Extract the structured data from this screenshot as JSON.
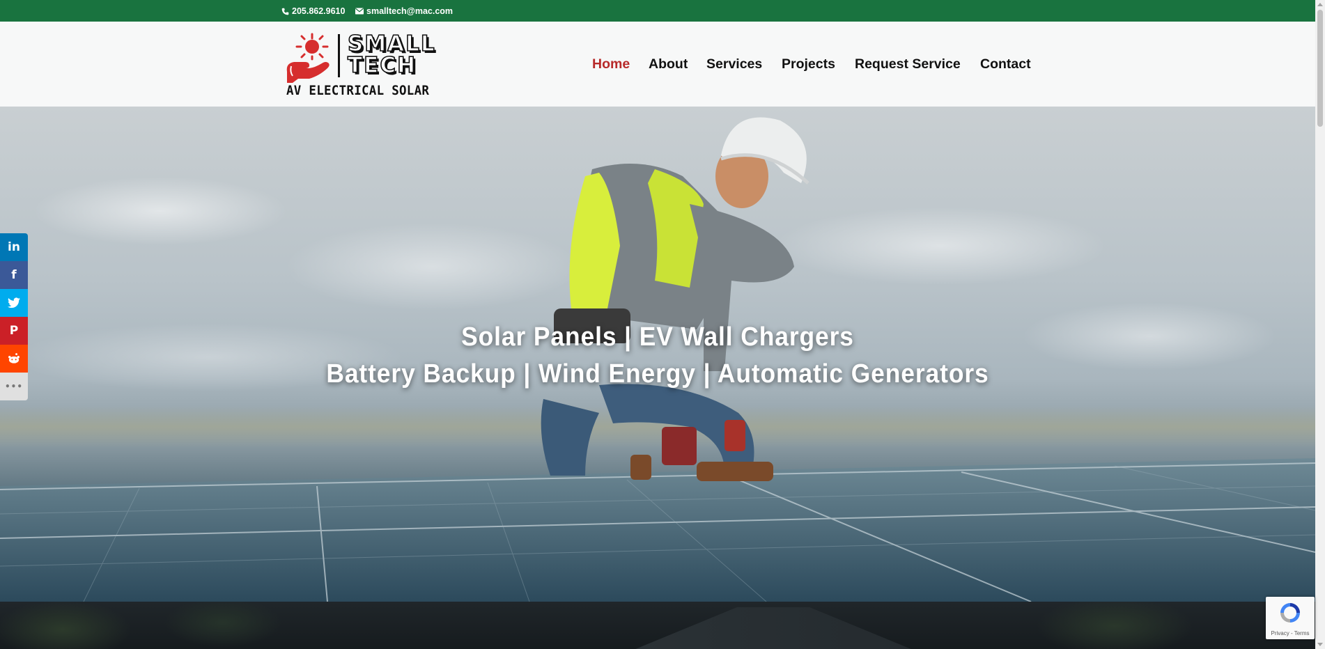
{
  "topbar": {
    "phone": "205.862.9610",
    "email": "smalltech@mac.com",
    "background_color": "#19733f"
  },
  "logo": {
    "line1": "SMALL",
    "line2": "TECH",
    "tagline": "AV ELECTRICAL SOLAR",
    "icon": "sun-hand-icon",
    "accent_color": "#d62e2e"
  },
  "nav": {
    "items": [
      {
        "label": "Home",
        "active": true
      },
      {
        "label": "About",
        "active": false
      },
      {
        "label": "Services",
        "active": false
      },
      {
        "label": "Projects",
        "active": false
      },
      {
        "label": "Request Service",
        "active": false
      },
      {
        "label": "Contact",
        "active": false
      }
    ],
    "active_color": "#b72a2a"
  },
  "hero": {
    "headline_line1": "Solar Panels | EV Wall Chargers",
    "headline_line2": "Battery Backup | Wind Energy | Automatic Generators"
  },
  "social": [
    {
      "icon": "linkedin-icon",
      "glyph": "in",
      "color": "#0077b5"
    },
    {
      "icon": "facebook-icon",
      "glyph": "f",
      "color": "#3b5998"
    },
    {
      "icon": "twitter-icon",
      "glyph": "🐦",
      "color": "#00acee"
    },
    {
      "icon": "pinterest-icon",
      "glyph": "P",
      "color": "#cb2027"
    },
    {
      "icon": "reddit-icon",
      "glyph": "◉",
      "color": "#ff4500"
    },
    {
      "icon": "more-icon",
      "glyph": "•••",
      "color": "#e0e0e0"
    }
  ],
  "recaptcha": {
    "terms": "Privacy - Terms"
  }
}
